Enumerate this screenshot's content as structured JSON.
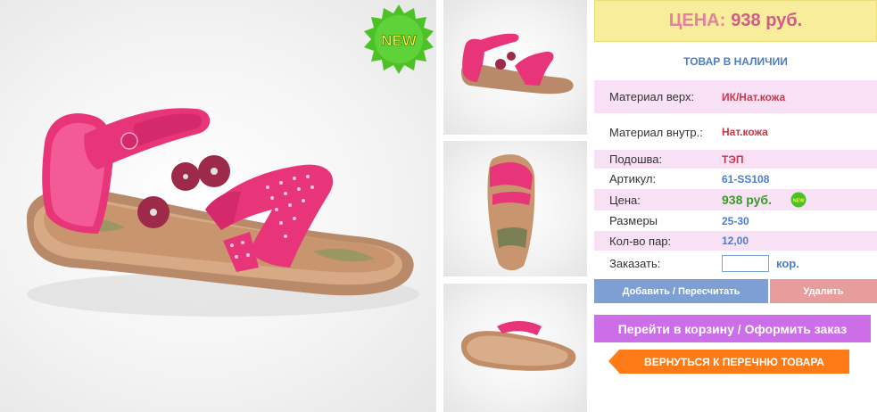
{
  "badge": {
    "text": "NEW"
  },
  "price_box": {
    "label": "ЦЕНА:",
    "value": "938 руб."
  },
  "stock_status": "ТОВАР В НАЛИЧИИ",
  "specs": [
    {
      "label": "Материал верх:",
      "value": "ИК/Нат.кожа"
    },
    {
      "label": "Материал внутр.:",
      "value": "Нат.кожа"
    },
    {
      "label": "Подошва:",
      "value": "ТЭП"
    },
    {
      "label": "Артикул:",
      "value": "61-SS108"
    },
    {
      "label": "Цена:",
      "value": "938 руб.",
      "badge": "NEW"
    },
    {
      "label": "Размеры",
      "value": "25-30"
    },
    {
      "label": "Кол-во пар:",
      "value": "12,00"
    }
  ],
  "order": {
    "label": "Заказать:",
    "value": "",
    "unit": "кор."
  },
  "buttons": {
    "add": "Добавить / Пересчитать",
    "delete": "Удалить",
    "cart": "Перейти в корзину / Оформить заказ",
    "back": "ВЕРНУТЬСЯ К ПЕРЕЧНЮ ТОВАРА"
  },
  "colors": {
    "price_bg": "#f7ed9a",
    "row_pink": "#f9e1f5",
    "add_btn": "#7d9fd3",
    "delete_btn": "#e89d9d",
    "cart_btn": "#cd6ee9",
    "back_btn": "#ff7b17",
    "sandal_pink": "#e8357a"
  }
}
